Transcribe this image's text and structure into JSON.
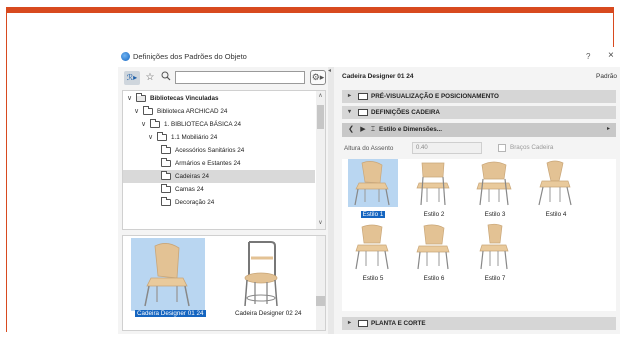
{
  "window": {
    "title": "Definições dos Padrões do Objeto",
    "help_label": "?",
    "close_label": "×"
  },
  "toolbar": {
    "mode_icon": "library-mode-icon",
    "favorite_icon": "star-icon",
    "search_icon": "search-icon",
    "search_placeholder": "",
    "gear_icon": "gear-icon"
  },
  "tree": {
    "items": [
      {
        "label": "Bibliotecas Vinculadas",
        "level": 0,
        "expanded": true,
        "bold": true
      },
      {
        "label": "Biblioteca ARCHICAD 24",
        "level": 1,
        "expanded": true
      },
      {
        "label": "1. BIBLIOTECA BÁSICA 24",
        "level": 2,
        "expanded": true
      },
      {
        "label": "1.1 Mobiliário 24",
        "level": 3,
        "expanded": true
      },
      {
        "label": "Acessórios Sanitários 24",
        "level": 4
      },
      {
        "label": "Armários e Estantes 24",
        "level": 4
      },
      {
        "label": "Cadeiras 24",
        "level": 4,
        "selected": true
      },
      {
        "label": "Camas 24",
        "level": 4
      },
      {
        "label": "Decoração 24",
        "level": 4
      }
    ]
  },
  "thumbnails": [
    {
      "label": "Cadeira Designer 01 24",
      "selected": true
    },
    {
      "label": "Cadeira Designer 02 24",
      "selected": false
    }
  ],
  "right": {
    "object_name": "Cadeira Designer 01 24",
    "default_label": "Padrão",
    "sections": {
      "preview": "PRÉ-VISUALIZAÇÃO E POSICIONAMENTO",
      "chair_settings": "DEFINIÇÕES CADEIRA",
      "plan": "PLANTA E CORTE"
    },
    "nav_title": "Estilo e Dimensões...",
    "seat_height_label": "Altura do Assento",
    "seat_height_value": "0.40",
    "arms_label": "Braços Cadeira",
    "styles": [
      {
        "label": "Estilo 1",
        "selected": true
      },
      {
        "label": "Estilo 2"
      },
      {
        "label": "Estilo 3"
      },
      {
        "label": "Estilo 4"
      },
      {
        "label": "Estilo 5"
      },
      {
        "label": "Estilo 6"
      },
      {
        "label": "Estilo 7"
      }
    ]
  },
  "colors": {
    "frame": "#d84a1f",
    "selection": "#1565c0",
    "selection_bg": "#b9d6f1",
    "chair_wood": "#e3c294"
  }
}
